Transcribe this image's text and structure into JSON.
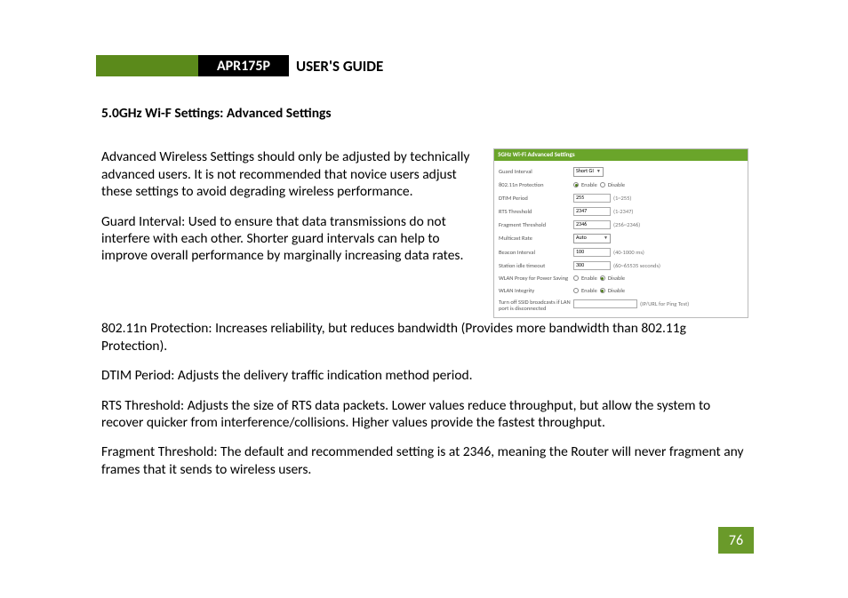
{
  "header": {
    "model": "APR175P",
    "title": "USER'S GUIDE"
  },
  "section_heading": "5.0GHz Wi-F Settings: Advanced Settings",
  "paragraphs": {
    "intro1": "Advanced Wireless Settings should only be adjusted by technically advanced users. It is not recommended that novice users adjust these settings to avoid degrading wireless performance.",
    "intro2": "Guard Interval: Used to ensure that data transmissions do not interfere with each other.  Shorter guard intervals can help to improve overall performance by marginally increasing data rates.",
    "p80211n": "802.11n Protection: Increases reliability, but reduces bandwidth (Provides more bandwidth than 802.11g Protection).",
    "dtim": "DTIM Period: Adjusts the delivery traffic indication method period.",
    "rts": "RTS Threshold: Adjusts the size of RTS data packets. Lower values reduce throughput, but allow the system to recover quicker from interference/collisions. Higher values provide the fastest throughput.",
    "frag": "Fragment Threshold: The default and recommended setting is at 2346, meaning the Router will never fragment any frames that it sends to wireless users."
  },
  "panel": {
    "title": "5GHz Wi-Fi Advanced Settings",
    "rows": {
      "guard_interval": {
        "label": "Guard Interval",
        "value": "Short GI"
      },
      "protection": {
        "label": "802.11n Protection",
        "enable": "Enable",
        "disable": "Disable"
      },
      "dtim": {
        "label": "DTIM Period",
        "value": "255",
        "hint": "(1~255)"
      },
      "rts": {
        "label": "RTS Threshold",
        "value": "2347",
        "hint": "(1-2347)"
      },
      "fragment": {
        "label": "Fragment Threshold",
        "value": "2346",
        "hint": "(256~2346)"
      },
      "multicast": {
        "label": "Multicast Rate",
        "value": "Auto"
      },
      "beacon": {
        "label": "Beacon Interval",
        "value": "100",
        "hint": "(40-1000 ms)"
      },
      "station": {
        "label": "Station idle timeout",
        "value": "300",
        "hint": "(60~65535 seconds)"
      },
      "wlan_proxy": {
        "label": "WLAN Proxy for Power Saving",
        "enable": "Enable",
        "disable": "Disable"
      },
      "wlan_integrity": {
        "label": "WLAN Integrity",
        "enable": "Enable",
        "disable": "Disable"
      },
      "turn_off": {
        "label": "Turn off SSID broadcasts if LAN port is disconnected",
        "value": "",
        "hint": "(IP/URL for Ping Test)"
      }
    }
  },
  "page_number": "76"
}
